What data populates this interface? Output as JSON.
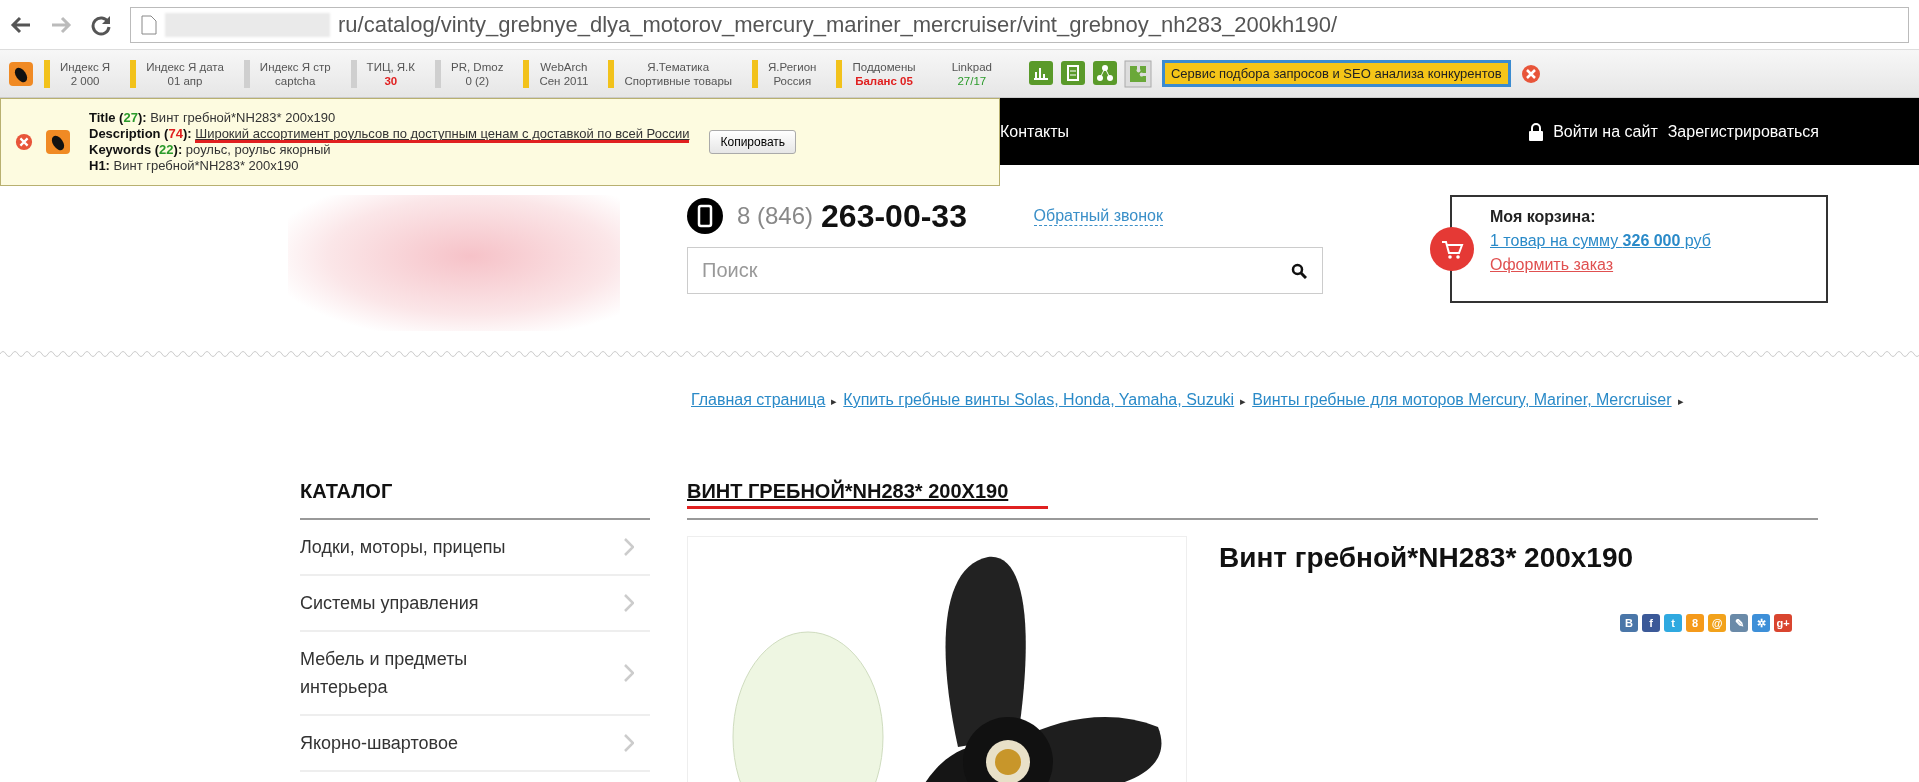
{
  "browser": {
    "url": "ru/catalog/vinty_grebnye_dlya_motorov_mercury_mariner_mercruiser/vint_grebnoy_nh283_200kh190/"
  },
  "seo_toolbar": {
    "items": [
      {
        "label": "Индекс Я",
        "value": "2 000",
        "alert": false,
        "ok": false,
        "color": "#f2c21b"
      },
      {
        "label": "Индекс Я дата",
        "value": "01 апр",
        "alert": false,
        "ok": false,
        "color": "#f2c21b"
      },
      {
        "label": "Индекс Я стр",
        "value": "captcha",
        "alert": false,
        "ok": false,
        "color": "#cfcfcf"
      },
      {
        "label": "ТИЦ, Я.К",
        "value": "30",
        "alert": true,
        "ok": false,
        "color": "#cfcfcf"
      },
      {
        "label": "PR, Dmoz",
        "value": "0 (2)",
        "alert": false,
        "ok": false,
        "color": "#cfcfcf"
      },
      {
        "label": "WebArch",
        "value": "Сен 2011",
        "alert": false,
        "ok": false,
        "color": "#f2c21b"
      },
      {
        "label": "Я.Тематика",
        "value": "Спортивные товары",
        "alert": false,
        "ok": false,
        "color": "#f2c21b"
      },
      {
        "label": "Я.Регион",
        "value": "Россия",
        "alert": false,
        "ok": false,
        "color": "#f2c21b"
      },
      {
        "label": "Поддомены",
        "value": "Баланс 05",
        "alert": true,
        "ok": false,
        "color": "#f2c21b"
      },
      {
        "label": "Linkpad",
        "value": "27/17",
        "alert": false,
        "ok": true
      }
    ],
    "service_button": "Сервис подбора запросов и SEO анализа конкурентов"
  },
  "popup": {
    "lines": [
      {
        "label": "Title (",
        "count": "27",
        "label_end": "):",
        "over_limit": false,
        "text": "Винт гребной*NH283* 200x190",
        "annotated": false
      },
      {
        "label": "Description (",
        "count": "74",
        "label_end": "):",
        "over_limit": true,
        "text": "Широкий ассортимент роульсов по доступным ценам с доставкой по всей России",
        "annotated": true
      },
      {
        "label": "Keywords (",
        "count": "22",
        "label_end": "):",
        "over_limit": false,
        "text": "роульс, роульс якорный",
        "annotated": false
      },
      {
        "label": "H1:",
        "text": "Винт гребной*NH283* 200x190",
        "annotated": false
      }
    ],
    "copy_button": "Копировать"
  },
  "nav": {
    "items": [
      "Контакты"
    ],
    "login": "Войти на сайт",
    "register": "Зарегистрироваться"
  },
  "header": {
    "phone_code": "8 (846)",
    "phone": "263-00-33",
    "callback": "Обратный звонок",
    "search": {
      "placeholder": "Поиск"
    },
    "cart": {
      "title": "Моя корзина:",
      "summary": "1 товар на сумму **326 000** руб",
      "checkout": "Оформить заказ"
    }
  },
  "breadcrumb": [
    {
      "label": "Главная страница",
      "separator": "▸"
    },
    {
      "label": "Купить гребные винты Solas, Honda, Yamaha, Suzuki",
      "separator": "▸"
    },
    {
      "label": "Винты гребные для моторов Mercury, Mariner, Mercruiser",
      "separator": "▸"
    }
  ],
  "catalog": {
    "title": "КАТАЛОГ",
    "items": [
      "Лодки, моторы, прицепы",
      "Системы управления",
      "Мебель и предметы интерьера",
      "Якорно-швартовое"
    ]
  },
  "product": {
    "heading": "ВИНТ ГРЕБНОЙ*NH283* 200X190",
    "heading_annotated": true,
    "title": "Винт гребной*NH283* 200x190",
    "share": [
      {
        "glyph": "B",
        "color": "#4a76a8"
      },
      {
        "glyph": "f",
        "color": "#3b5998"
      },
      {
        "glyph": "t",
        "color": "#2fa9e0"
      },
      {
        "glyph": "8",
        "color": "#f59a1b"
      },
      {
        "glyph": "@",
        "color": "#f2a21b"
      },
      {
        "glyph": "✎",
        "color": "#6a8aa8"
      },
      {
        "glyph": "✲",
        "color": "#3d8fd8"
      },
      {
        "glyph": "g+",
        "color": "#d9452f"
      }
    ]
  }
}
